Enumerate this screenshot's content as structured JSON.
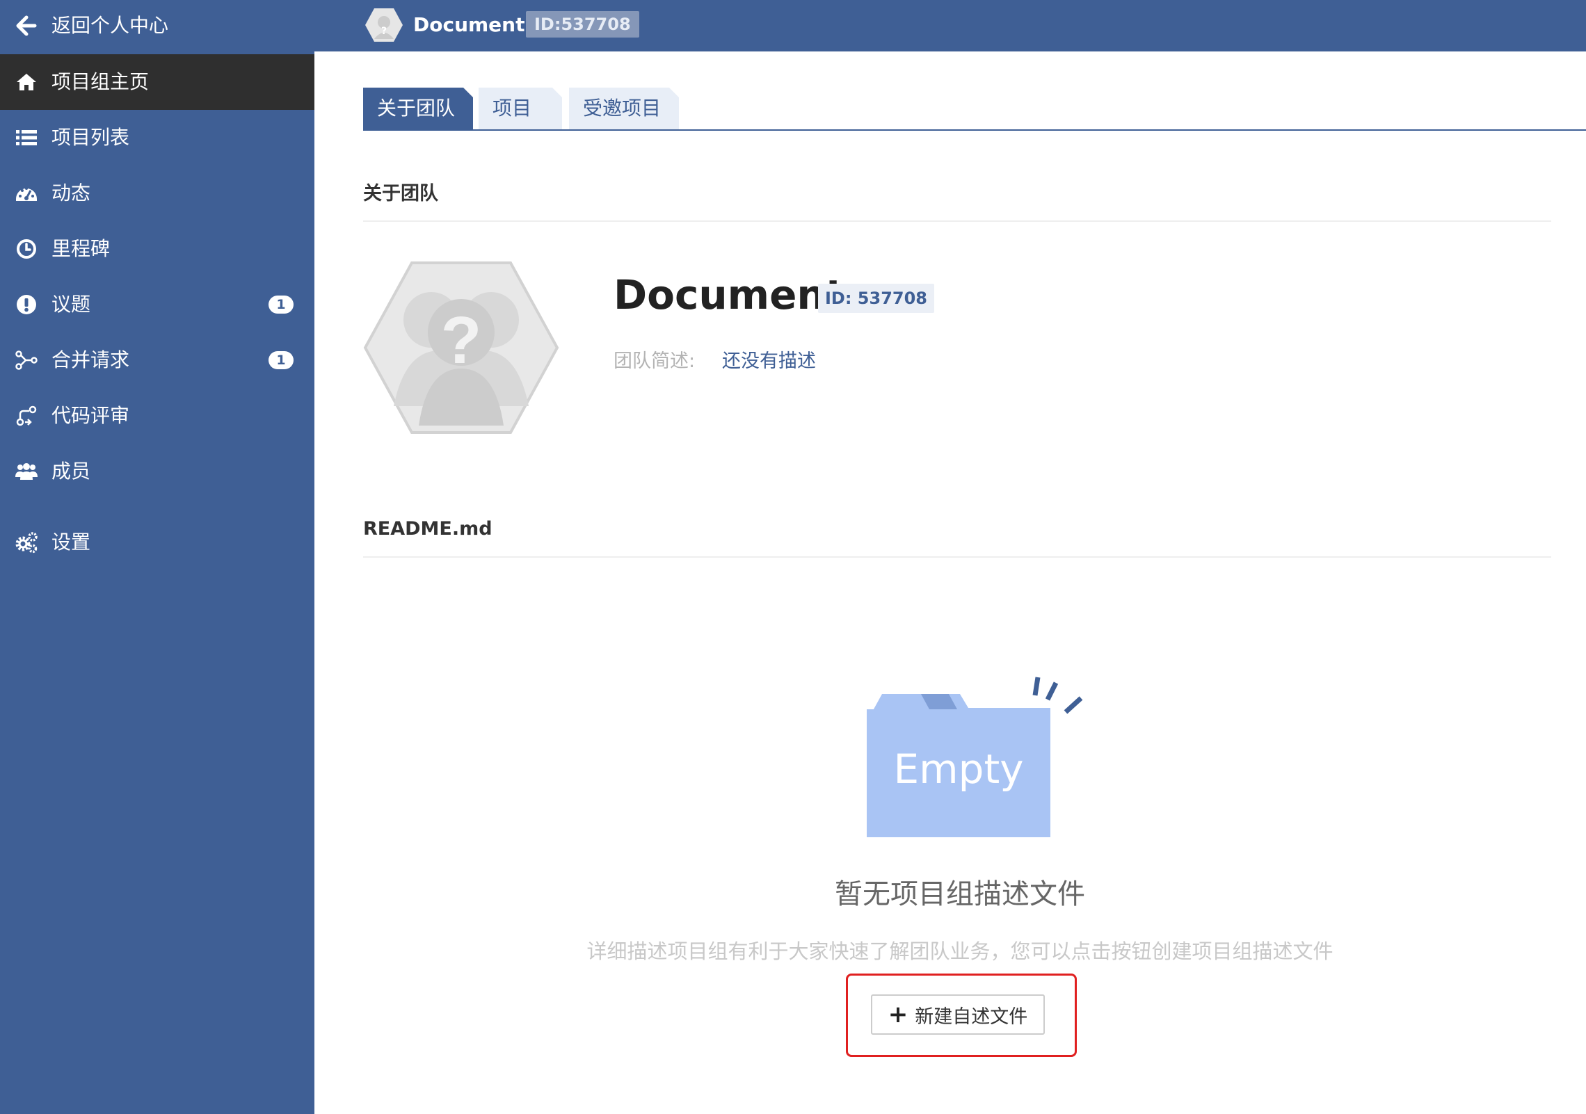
{
  "sidebar": {
    "back_label": "返回个人中心",
    "items": [
      {
        "label": "项目组主页",
        "icon": "home-icon",
        "active": true
      },
      {
        "label": "项目列表",
        "icon": "list-icon"
      },
      {
        "label": "动态",
        "icon": "dashboard-icon"
      },
      {
        "label": "里程碑",
        "icon": "clock-icon"
      },
      {
        "label": "议题",
        "icon": "exclamation-icon",
        "badge": "1"
      },
      {
        "label": "合并请求",
        "icon": "merge-icon",
        "badge": "1"
      },
      {
        "label": "代码评审",
        "icon": "code-review-icon"
      },
      {
        "label": "成员",
        "icon": "users-icon"
      },
      {
        "label": "设置",
        "icon": "gears-icon"
      }
    ]
  },
  "header": {
    "title": "Document",
    "id_badge": "ID:537708"
  },
  "tabs": [
    {
      "label": "关于团队",
      "active": true
    },
    {
      "label": "项目"
    },
    {
      "label": "受邀项目"
    }
  ],
  "about": {
    "section_title": "关于团队",
    "team_name": "Document",
    "team_id": "ID: 537708",
    "desc_label": "团队简述:",
    "desc_value": "还没有描述"
  },
  "readme": {
    "section_title": "README.md",
    "empty_image_text": "Empty",
    "empty_title": "暂无项目组描述文件",
    "empty_desc": "详细描述项目组有利于大家快速了解团队业务，您可以点击按钮创建项目组描述文件",
    "create_button": "新建自述文件"
  },
  "colors": {
    "brand": "#3f5f95",
    "sidebar_active": "#2f2f2f",
    "highlight": "#e02020",
    "empty_folder": "#a9c4f4"
  }
}
